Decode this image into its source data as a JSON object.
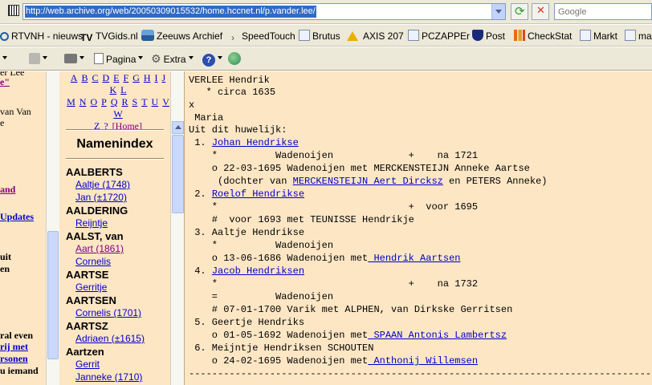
{
  "address_bar": {
    "url": "http://web.archive.org/web/20050309015532/home.hccnet.nl/p.vander.lee/",
    "search_placeholder": "Google"
  },
  "links_bar": {
    "items": [
      "RTVNH - nieuws",
      "TVGids.nl",
      "Zeeuws Archief",
      "SpeedTouch",
      "Brutus",
      "AXIS 207",
      "PCZAPPEr",
      "Post",
      "CheckStat",
      "Markt",
      "ma"
    ]
  },
  "command_bar": {
    "page": "Pagina",
    "extra": "Extra"
  },
  "left_frame": {
    "lines": [
      "er Lee",
      "e\"",
      "van Van",
      "e",
      "and",
      "Updates",
      "uit",
      "en",
      "ral even",
      "rij met",
      "rsonen",
      "u iemand"
    ]
  },
  "alpha_index": {
    "letters_row1": [
      "A",
      "B",
      "C",
      "D",
      "E",
      "F",
      "G",
      "H",
      "I",
      "J",
      "K",
      "L"
    ],
    "letters_row2": [
      "M",
      "N",
      "O",
      "P",
      "Q",
      "R",
      "S",
      "T",
      "U",
      "V",
      "W"
    ],
    "letters_row3": [
      "Z",
      "?"
    ],
    "home": "[Home]"
  },
  "name_index": {
    "title": "Namenindex",
    "entries": [
      {
        "type": "family",
        "text": "AALBERTS"
      },
      {
        "type": "child",
        "text": "Aaltje (1748)"
      },
      {
        "type": "child",
        "text": "Jan (±1720)"
      },
      {
        "type": "family",
        "text": "AALDERING"
      },
      {
        "type": "child",
        "text": "Reijntje"
      },
      {
        "type": "family",
        "text": "AALST, van"
      },
      {
        "type": "child-visited",
        "text": "Aart (1861)"
      },
      {
        "type": "child",
        "text": "Cornelis"
      },
      {
        "type": "family",
        "text": "AARTSE"
      },
      {
        "type": "child",
        "text": "Gerritje"
      },
      {
        "type": "family",
        "text": "AARTSEN"
      },
      {
        "type": "child",
        "text": "Cornelis (1701)"
      },
      {
        "type": "family",
        "text": "AARTSZ"
      },
      {
        "type": "child",
        "text": "Adriaen (±1615)"
      },
      {
        "type": "family",
        "text": "Aartzen"
      },
      {
        "type": "child",
        "text": "Gerrit"
      },
      {
        "type": "child",
        "text": "Janneke (1710)"
      }
    ]
  },
  "genealogy": {
    "l1": "VERLEE Hendrik",
    "l2": "   * circa 1635",
    "l3": "x",
    "l4": " Maria",
    "l5": "Uit dit huwelijk:",
    "l6_pre": " 1. ",
    "l6_link": "Johan Hendrikse",
    "l7": "    *          Wadenoijen             +    na 1721",
    "l8": "    o 22-03-1695 Wadenoijen met MERCKENSTEIJN Anneke Aartse",
    "l9_pre": "     (dochter van ",
    "l9_link": "MERCKENSTEIJN Aert Dircksz",
    "l9_post": " en PETERS Anneke)",
    "l10_pre": " 2. ",
    "l10_link": "Roelof Hendrikse",
    "l11": "    *                                 +  voor 1695",
    "l12": "    #  voor 1693 met TEUNISSE Hendrikje",
    "l13": " 3. Aaltje Hendrikse",
    "l14": "    *          Wadenoijen",
    "l15_pre": "    o 13-06-1686 Wadenoijen met",
    "l15_link": " Hendrik Aartsen",
    "l16_pre": " 4. ",
    "l16_link": "Jacob Hendriksen",
    "l17": "    *                                 +    na 1732",
    "l18": "    =          Wadenoijen",
    "l19": "    # 07-01-1700 Varik met ALPHEN, van Dirkske Gerritsen",
    "l20": " 5. Geertje Hendriks",
    "l21_pre": "    o 01-05-1692 Wadenoijen met",
    "l21_link": " SPAAN Antonis Lambertsz",
    "l22": " 6. Meijntje Hendriksen SCHOUTEN",
    "l23_pre": "    o 24-02-1695 Wadenoijen met",
    "l23_link": " Anthonij Willemsen",
    "l24": "------------------------------------------------------------------------------------------"
  }
}
